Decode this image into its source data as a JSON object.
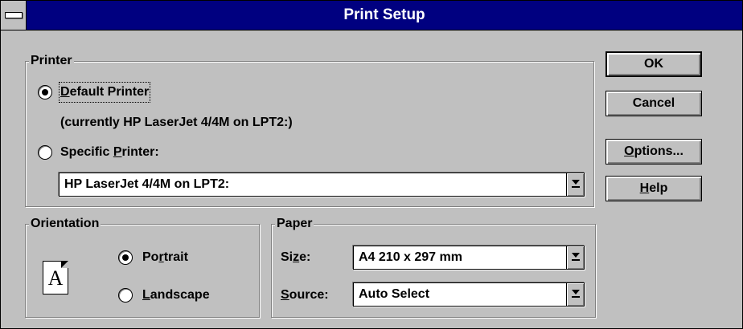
{
  "window": {
    "title": "Print Setup"
  },
  "printer_group": {
    "legend": "Printer",
    "default_label_pre": "",
    "default_label_u": "D",
    "default_label_post": "efault Printer",
    "currently_text": "(currently HP LaserJet 4/4M on LPT2:)",
    "specific_label_pre": "Specific ",
    "specific_label_u": "P",
    "specific_label_post": "rinter:",
    "selected": "Default Printer",
    "printer_select_value": "HP LaserJet 4/4M on LPT2:"
  },
  "orientation_group": {
    "legend": "Orientation",
    "portrait_pre": "Po",
    "portrait_u": "r",
    "portrait_post": "trait",
    "landscape_pre": "",
    "landscape_u": "L",
    "landscape_post": "andscape",
    "selected": "Portrait",
    "icon_letter": "A"
  },
  "paper_group": {
    "legend": "Paper",
    "size_pre": "Si",
    "size_u": "z",
    "size_post": "e:",
    "size_value": "A4 210 x 297 mm",
    "source_pre": "",
    "source_u": "S",
    "source_post": "ource:",
    "source_value": "Auto Select"
  },
  "buttons": {
    "ok": "OK",
    "cancel": "Cancel",
    "options_u": "O",
    "options_post": "ptions...",
    "help_u": "H",
    "help_post": "elp"
  }
}
